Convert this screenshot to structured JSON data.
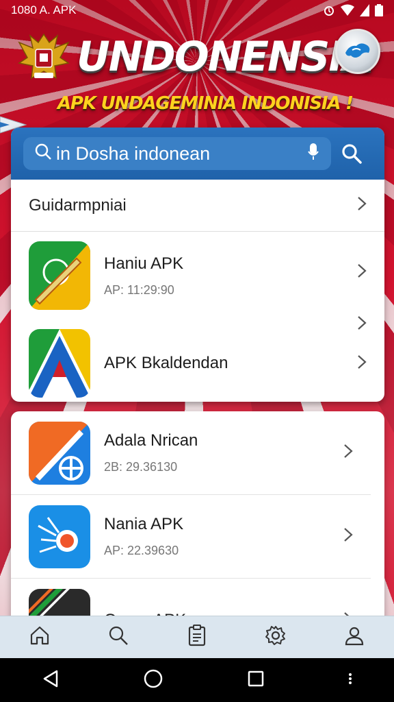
{
  "status_bar": {
    "time_label": "1080 A. APK"
  },
  "header": {
    "title": "UNDONENSIA",
    "subtitle": "APK UNDAGEMINIA INDONISIA !"
  },
  "search": {
    "placeholder": "in Dosha indonean",
    "search_icon": "search-icon",
    "mic_icon": "microphone-icon"
  },
  "category": {
    "label": "Guidarmpniai"
  },
  "apps": [
    {
      "name": "Haniu APK",
      "meta": "AP: 11:29:90"
    },
    {
      "name": "APK Bkaldendan",
      "meta": ""
    }
  ],
  "apps_more": [
    {
      "name": "Adala Nrican",
      "meta": "2B: 29.36130"
    },
    {
      "name": "Nania APK",
      "meta": "AP: 22.39630"
    },
    {
      "name": "Oaner APK",
      "meta": ""
    }
  ],
  "bottom_nav": [
    {
      "icon": "home-icon"
    },
    {
      "icon": "search-icon"
    },
    {
      "icon": "clipboard-icon"
    },
    {
      "icon": "settings-icon"
    },
    {
      "icon": "profile-icon"
    }
  ],
  "colors": {
    "primary_blue": "#1f62aa",
    "header_red": "#c8102e",
    "subtitle_yellow": "#ffd21f"
  }
}
